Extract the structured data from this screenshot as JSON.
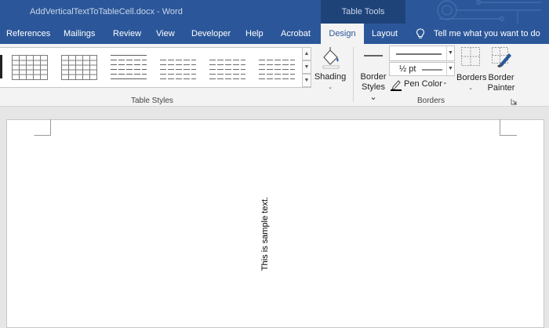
{
  "window": {
    "title": "AddVerticalTextToTableCell.docx - Word",
    "context_group": "Table Tools"
  },
  "tabs": [
    {
      "label": "References"
    },
    {
      "label": "Mailings"
    },
    {
      "label": "Review"
    },
    {
      "label": "View"
    },
    {
      "label": "Developer"
    },
    {
      "label": "Help"
    },
    {
      "label": "Acrobat"
    },
    {
      "label": "Design",
      "active": true
    },
    {
      "label": "Layout"
    }
  ],
  "tell_me": {
    "label": "Tell me what you want to do",
    "icon": "lightbulb-icon"
  },
  "ribbon": {
    "table_styles": {
      "label": "Table Styles"
    },
    "shading": {
      "label": "Shading",
      "icon": "paint-bucket-icon"
    },
    "borders_group": {
      "label": "Borders",
      "border_styles": {
        "line1": "Border",
        "line2": "Styles"
      },
      "line_weight": "½ pt",
      "pen_color": {
        "label": "Pen Color",
        "color": "#000000"
      },
      "borders": {
        "label": "Borders"
      },
      "border_painter": {
        "line1": "Border",
        "line2": "Painter"
      }
    }
  },
  "document": {
    "vertical_text": "This is sample text."
  },
  "colors": {
    "accent": "#2b579a",
    "context_group": "#1e4379"
  }
}
